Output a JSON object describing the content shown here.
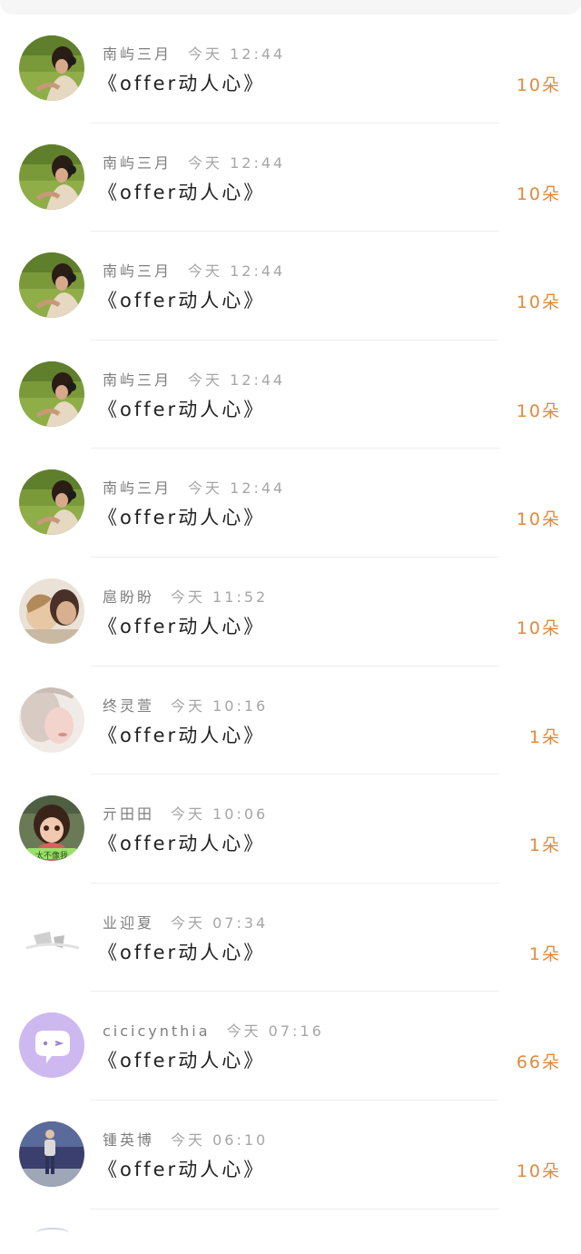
{
  "rows": [
    {
      "name": "南屿三月",
      "time": "今天 12:44",
      "title": "《offer动人心》",
      "count": "10朵",
      "avatar": "headphones-photo"
    },
    {
      "name": "南屿三月",
      "time": "今天 12:44",
      "title": "《offer动人心》",
      "count": "10朵",
      "avatar": "headphones-photo"
    },
    {
      "name": "南屿三月",
      "time": "今天 12:44",
      "title": "《offer动人心》",
      "count": "10朵",
      "avatar": "headphones-photo"
    },
    {
      "name": "南屿三月",
      "time": "今天 12:44",
      "title": "《offer动人心》",
      "count": "10朵",
      "avatar": "headphones-photo"
    },
    {
      "name": "南屿三月",
      "time": "今天 12:44",
      "title": "《offer动人心》",
      "count": "10朵",
      "avatar": "headphones-photo"
    },
    {
      "name": "扈盼盼",
      "time": "今天 11:52",
      "title": "《offer动人心》",
      "count": "10朵",
      "avatar": "couple-photo"
    },
    {
      "name": "终灵萱",
      "time": "今天 10:16",
      "title": "《offer动人心》",
      "count": "1朵",
      "avatar": "soft-face-photo"
    },
    {
      "name": "亓田田",
      "time": "今天 10:06",
      "title": "《offer动人心》",
      "count": "1朵",
      "avatar": "girl-photo"
    },
    {
      "name": "业迎夏",
      "time": "今天 07:34",
      "title": "《offer动人心》",
      "count": "1朵",
      "avatar": "gray-sketch"
    },
    {
      "name": "cicicynthia",
      "time": "今天 07:16",
      "title": "《offer动人心》",
      "count": "66朵",
      "avatar": "chat-bubble-icon"
    },
    {
      "name": "锺英博",
      "time": "今天 06:10",
      "title": "《offer动人心》",
      "count": "10朵",
      "avatar": "walking-man-photo"
    }
  ],
  "avatar_badge": "太不像我",
  "colors": {
    "count": "#e08a3c",
    "name": "#7e7e7e",
    "time": "#a6a6a6",
    "title": "#222222",
    "divider": "#eeeeee",
    "chat_icon_bg": "#cdb8f0"
  }
}
